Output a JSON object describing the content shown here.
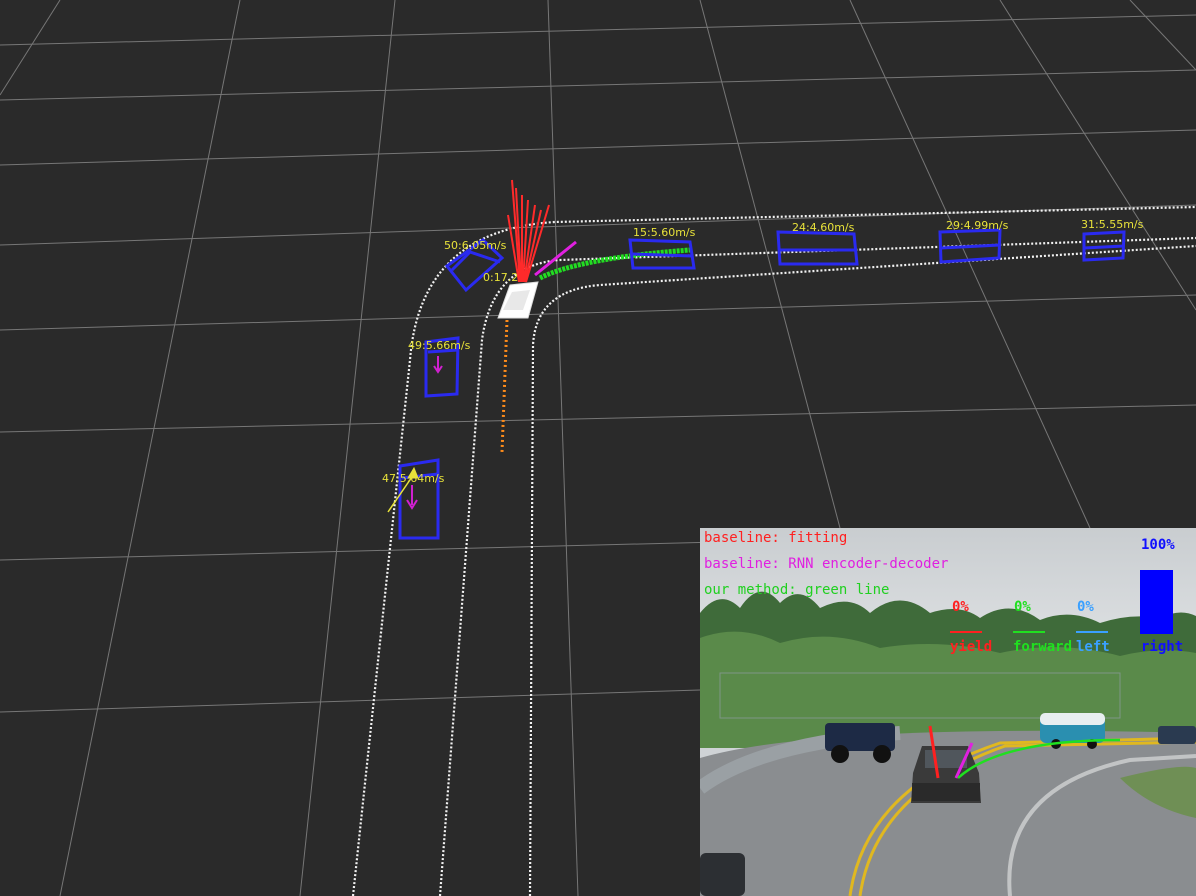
{
  "vehicles": [
    {
      "label": "50:6.05m/s"
    },
    {
      "label": "0:17.2"
    },
    {
      "label": "15:5.60m/s"
    },
    {
      "label": "24:4.60m/s"
    },
    {
      "label": "29:4.99m/s"
    },
    {
      "label": "31:5.55m/s"
    },
    {
      "label": "49:5.66m/s"
    },
    {
      "label": "47:5.64m/s"
    }
  ],
  "camera": {
    "legend": [
      {
        "text": "baseline: fitting",
        "color": "#ff2020"
      },
      {
        "text": "baseline: RNN encoder-decoder",
        "color": "#e020e0"
      },
      {
        "text": "our method: green line",
        "color": "#20d020"
      }
    ],
    "intents": [
      {
        "percent": "0%",
        "label": "yield",
        "color": "#ff2020"
      },
      {
        "percent": "0%",
        "label": "forward",
        "color": "#20e020"
      },
      {
        "percent": "0%",
        "label": "left",
        "color": "#3aa0ff"
      },
      {
        "percent": "100%",
        "label": "right",
        "color": "#1010ff",
        "level": 1.0
      }
    ]
  }
}
